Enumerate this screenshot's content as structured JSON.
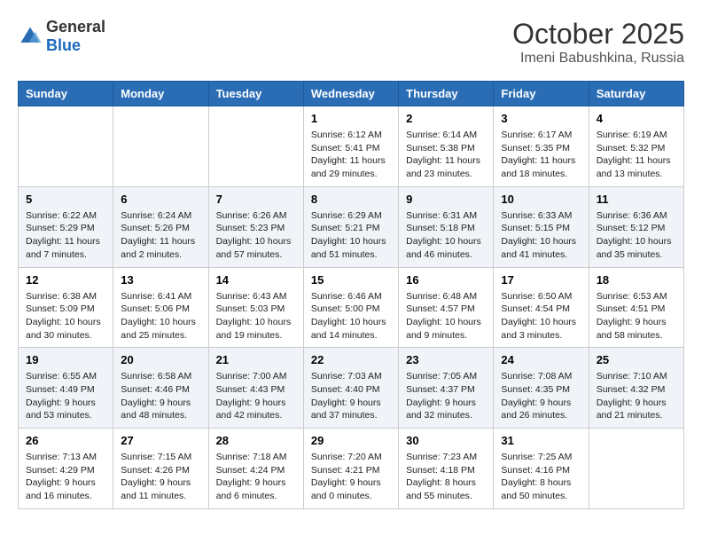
{
  "header": {
    "logo_general": "General",
    "logo_blue": "Blue",
    "month": "October 2025",
    "location": "Imeni Babushkina, Russia"
  },
  "days_of_week": [
    "Sunday",
    "Monday",
    "Tuesday",
    "Wednesday",
    "Thursday",
    "Friday",
    "Saturday"
  ],
  "weeks": [
    [
      {
        "day": "",
        "info": ""
      },
      {
        "day": "",
        "info": ""
      },
      {
        "day": "",
        "info": ""
      },
      {
        "day": "1",
        "info": "Sunrise: 6:12 AM\nSunset: 5:41 PM\nDaylight: 11 hours\nand 29 minutes."
      },
      {
        "day": "2",
        "info": "Sunrise: 6:14 AM\nSunset: 5:38 PM\nDaylight: 11 hours\nand 23 minutes."
      },
      {
        "day": "3",
        "info": "Sunrise: 6:17 AM\nSunset: 5:35 PM\nDaylight: 11 hours\nand 18 minutes."
      },
      {
        "day": "4",
        "info": "Sunrise: 6:19 AM\nSunset: 5:32 PM\nDaylight: 11 hours\nand 13 minutes."
      }
    ],
    [
      {
        "day": "5",
        "info": "Sunrise: 6:22 AM\nSunset: 5:29 PM\nDaylight: 11 hours\nand 7 minutes."
      },
      {
        "day": "6",
        "info": "Sunrise: 6:24 AM\nSunset: 5:26 PM\nDaylight: 11 hours\nand 2 minutes."
      },
      {
        "day": "7",
        "info": "Sunrise: 6:26 AM\nSunset: 5:23 PM\nDaylight: 10 hours\nand 57 minutes."
      },
      {
        "day": "8",
        "info": "Sunrise: 6:29 AM\nSunset: 5:21 PM\nDaylight: 10 hours\nand 51 minutes."
      },
      {
        "day": "9",
        "info": "Sunrise: 6:31 AM\nSunset: 5:18 PM\nDaylight: 10 hours\nand 46 minutes."
      },
      {
        "day": "10",
        "info": "Sunrise: 6:33 AM\nSunset: 5:15 PM\nDaylight: 10 hours\nand 41 minutes."
      },
      {
        "day": "11",
        "info": "Sunrise: 6:36 AM\nSunset: 5:12 PM\nDaylight: 10 hours\nand 35 minutes."
      }
    ],
    [
      {
        "day": "12",
        "info": "Sunrise: 6:38 AM\nSunset: 5:09 PM\nDaylight: 10 hours\nand 30 minutes."
      },
      {
        "day": "13",
        "info": "Sunrise: 6:41 AM\nSunset: 5:06 PM\nDaylight: 10 hours\nand 25 minutes."
      },
      {
        "day": "14",
        "info": "Sunrise: 6:43 AM\nSunset: 5:03 PM\nDaylight: 10 hours\nand 19 minutes."
      },
      {
        "day": "15",
        "info": "Sunrise: 6:46 AM\nSunset: 5:00 PM\nDaylight: 10 hours\nand 14 minutes."
      },
      {
        "day": "16",
        "info": "Sunrise: 6:48 AM\nSunset: 4:57 PM\nDaylight: 10 hours\nand 9 minutes."
      },
      {
        "day": "17",
        "info": "Sunrise: 6:50 AM\nSunset: 4:54 PM\nDaylight: 10 hours\nand 3 minutes."
      },
      {
        "day": "18",
        "info": "Sunrise: 6:53 AM\nSunset: 4:51 PM\nDaylight: 9 hours\nand 58 minutes."
      }
    ],
    [
      {
        "day": "19",
        "info": "Sunrise: 6:55 AM\nSunset: 4:49 PM\nDaylight: 9 hours\nand 53 minutes."
      },
      {
        "day": "20",
        "info": "Sunrise: 6:58 AM\nSunset: 4:46 PM\nDaylight: 9 hours\nand 48 minutes."
      },
      {
        "day": "21",
        "info": "Sunrise: 7:00 AM\nSunset: 4:43 PM\nDaylight: 9 hours\nand 42 minutes."
      },
      {
        "day": "22",
        "info": "Sunrise: 7:03 AM\nSunset: 4:40 PM\nDaylight: 9 hours\nand 37 minutes."
      },
      {
        "day": "23",
        "info": "Sunrise: 7:05 AM\nSunset: 4:37 PM\nDaylight: 9 hours\nand 32 minutes."
      },
      {
        "day": "24",
        "info": "Sunrise: 7:08 AM\nSunset: 4:35 PM\nDaylight: 9 hours\nand 26 minutes."
      },
      {
        "day": "25",
        "info": "Sunrise: 7:10 AM\nSunset: 4:32 PM\nDaylight: 9 hours\nand 21 minutes."
      }
    ],
    [
      {
        "day": "26",
        "info": "Sunrise: 7:13 AM\nSunset: 4:29 PM\nDaylight: 9 hours\nand 16 minutes."
      },
      {
        "day": "27",
        "info": "Sunrise: 7:15 AM\nSunset: 4:26 PM\nDaylight: 9 hours\nand 11 minutes."
      },
      {
        "day": "28",
        "info": "Sunrise: 7:18 AM\nSunset: 4:24 PM\nDaylight: 9 hours\nand 6 minutes."
      },
      {
        "day": "29",
        "info": "Sunrise: 7:20 AM\nSunset: 4:21 PM\nDaylight: 9 hours\nand 0 minutes."
      },
      {
        "day": "30",
        "info": "Sunrise: 7:23 AM\nSunset: 4:18 PM\nDaylight: 8 hours\nand 55 minutes."
      },
      {
        "day": "31",
        "info": "Sunrise: 7:25 AM\nSunset: 4:16 PM\nDaylight: 8 hours\nand 50 minutes."
      },
      {
        "day": "",
        "info": ""
      }
    ]
  ]
}
